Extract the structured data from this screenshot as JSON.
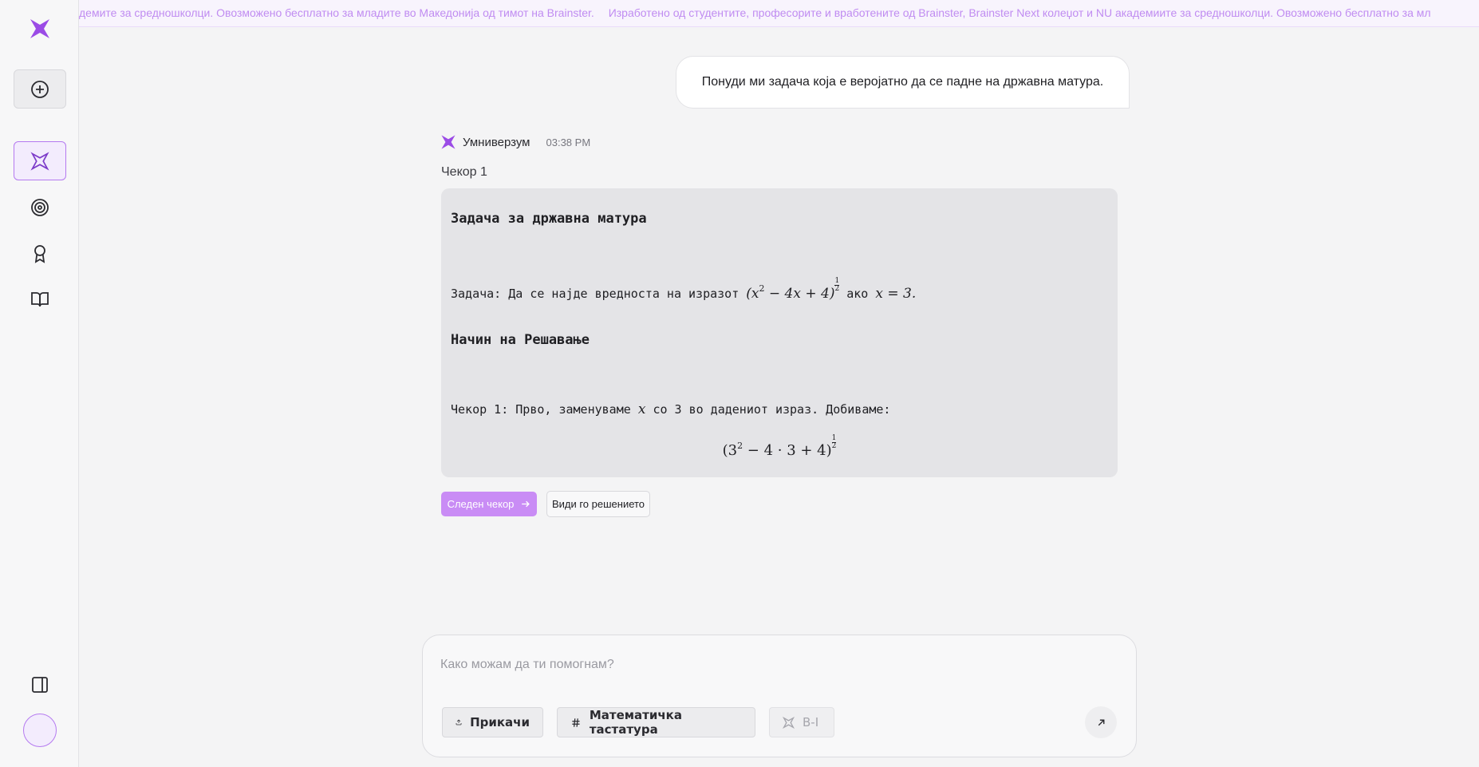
{
  "ticker": {
    "segment_a": "демите за средношколци. Овозможено бесплатно за младите во Македонија од тимот на Brainster.",
    "segment_b": "Изработено од студентите, професорите и вработените од Brainster, Brainster Next колеџот и NU академиите за средношколци. Овозможено бесплатно за мл"
  },
  "user_message": "Понуди ми задача која е веројатно да се падне на државна матура.",
  "assistant": {
    "name": "Умниверзум",
    "time": "03:38 PM",
    "step_title": "Чекор 1",
    "card": {
      "heading": "Задача за државна матура",
      "task_prefix": "Задача: Да се најде вредноста на изразот",
      "task_if": "ако",
      "solution_heading": "Начин на Решавање",
      "step_prefix": "Чекор 1: Прво, заменуваме",
      "step_suffix": "со 3 во дадениот израз. Добиваме:"
    },
    "next_button": "Следен чекор",
    "solution_button": "Види го решението"
  },
  "composer": {
    "placeholder": "Како можам да ти помогнам?",
    "attach_label": "Прикачи",
    "keyboard_label": "Математичка тастатура",
    "model_label": "B-I"
  },
  "colors": {
    "accent": "#c98cf5",
    "accent_border": "#b57af0",
    "logo": "#9b4be6",
    "ticker_text": "#c08cf1"
  },
  "icons": {
    "logo": "star-logo-icon",
    "new_chat": "plus-circle-icon",
    "tutor": "star-logo-icon",
    "goals": "target-icon",
    "achievements": "award-icon",
    "library": "book-open-icon",
    "panel": "sidebar-toggle-icon",
    "next": "arrow-right-icon",
    "attach": "upload-icon",
    "keyboard": "hash-icon",
    "send": "arrow-up-right-icon"
  }
}
